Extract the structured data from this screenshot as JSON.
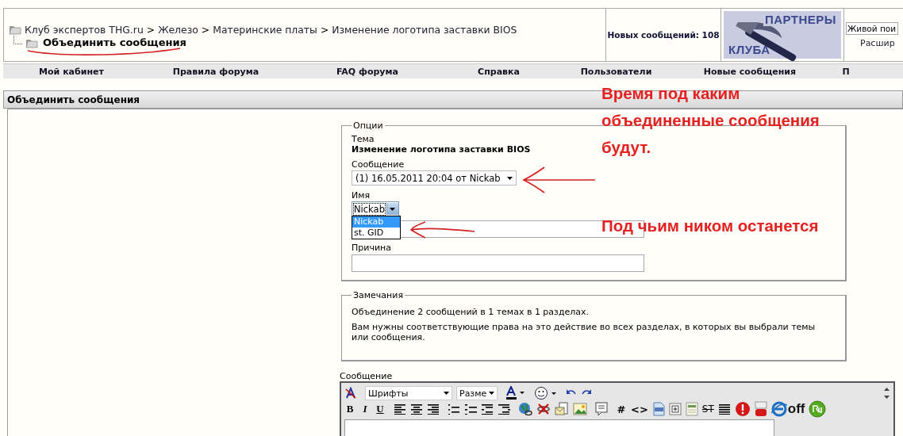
{
  "breadcrumb": {
    "links": [
      "Клуб экспертов THG.ru",
      "Железо",
      "Материнские платы",
      "Изменение логотипа заставки BIOS"
    ],
    "separator": ">",
    "current": "Объединить сообщения"
  },
  "header": {
    "new_posts": "Новых сообщений: 108",
    "banner": {
      "line1": "ПАРТНЕРЫ",
      "line2": "КЛУБА"
    },
    "search": {
      "value": "Живой пои"
    },
    "advanced_link": "Расшир"
  },
  "navbar": [
    "Мой кабинет",
    "Правила форума",
    "FAQ форума",
    "Справка",
    "Пользователи",
    "Новые сообщения",
    "П"
  ],
  "panel": {
    "title": "Объединить сообщения",
    "options": {
      "legend": "Опции",
      "topic_label": "Тема",
      "topic": "Изменение логотипа заставки BIOS",
      "message_label": "Сообщение",
      "message_value": "(1) 16.05.2011 20:04 от Nickab",
      "name_label": "Имя",
      "name_value": "Nickab",
      "name_dropdown": {
        "expanded": true,
        "options": [
          {
            "label": "Nickab",
            "selected": true
          },
          {
            "label": "st. GID",
            "selected": false
          }
        ]
      },
      "reason_label": "Причина"
    },
    "notes": {
      "legend": "Замечания",
      "lines": [
        "Объединение 2 сообщений в 1 темах в 1 разделах.",
        "Вам нужны соответствующие права на это действие во всех разделах, в которых вы выбрали темы или сообщения."
      ]
    },
    "editor": {
      "label": "Сообщение",
      "font_select": "Шрифты",
      "size_select": "Разме",
      "format_buttons": [
        "B",
        "I",
        "U"
      ],
      "tag_buttons": [
        "#",
        "<>"
      ],
      "strike_button": "ST",
      "off_label": "off"
    }
  },
  "annotations": [
    {
      "text": "Время под каким объединенные сообщения будут."
    },
    {
      "text": "Под чьим ником останется"
    }
  ]
}
